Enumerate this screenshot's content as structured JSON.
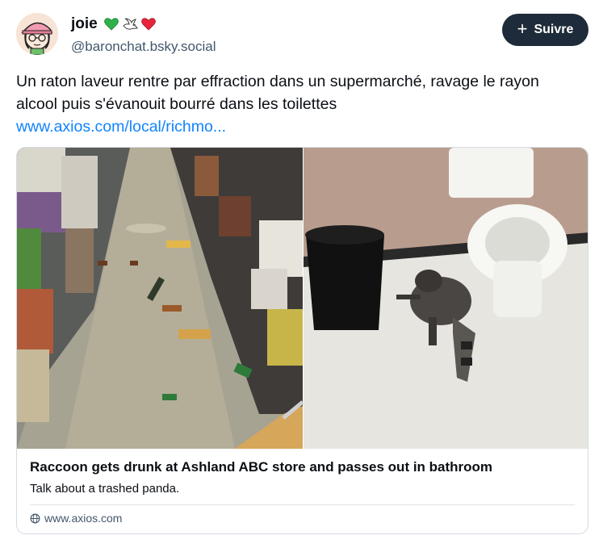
{
  "author": {
    "display_name": "joie",
    "handle": "@baronchat.bsky.social",
    "emojis": [
      "green-heart-icon",
      "dove-icon",
      "red-heart-icon"
    ]
  },
  "follow_button": {
    "label": "Suivre",
    "icon": "plus-icon"
  },
  "post": {
    "text": "Un raton laveur rentre par effraction dans un supermarché, ravage le rayon alcool puis s'évanouit bourré dans les toilettes",
    "link_text": "www.axios.com/local/richmo..."
  },
  "link_card": {
    "title": "Raccoon gets drunk at Ashland ABC store and passes out in bathroom",
    "description": "Talk about a trashed panda.",
    "domain": "www.axios.com",
    "domain_icon": "globe-icon"
  },
  "colors": {
    "link": "#1083fe",
    "button_bg": "#1e2b3a",
    "handle": "#42576c",
    "card_border": "#d4dbe2"
  }
}
